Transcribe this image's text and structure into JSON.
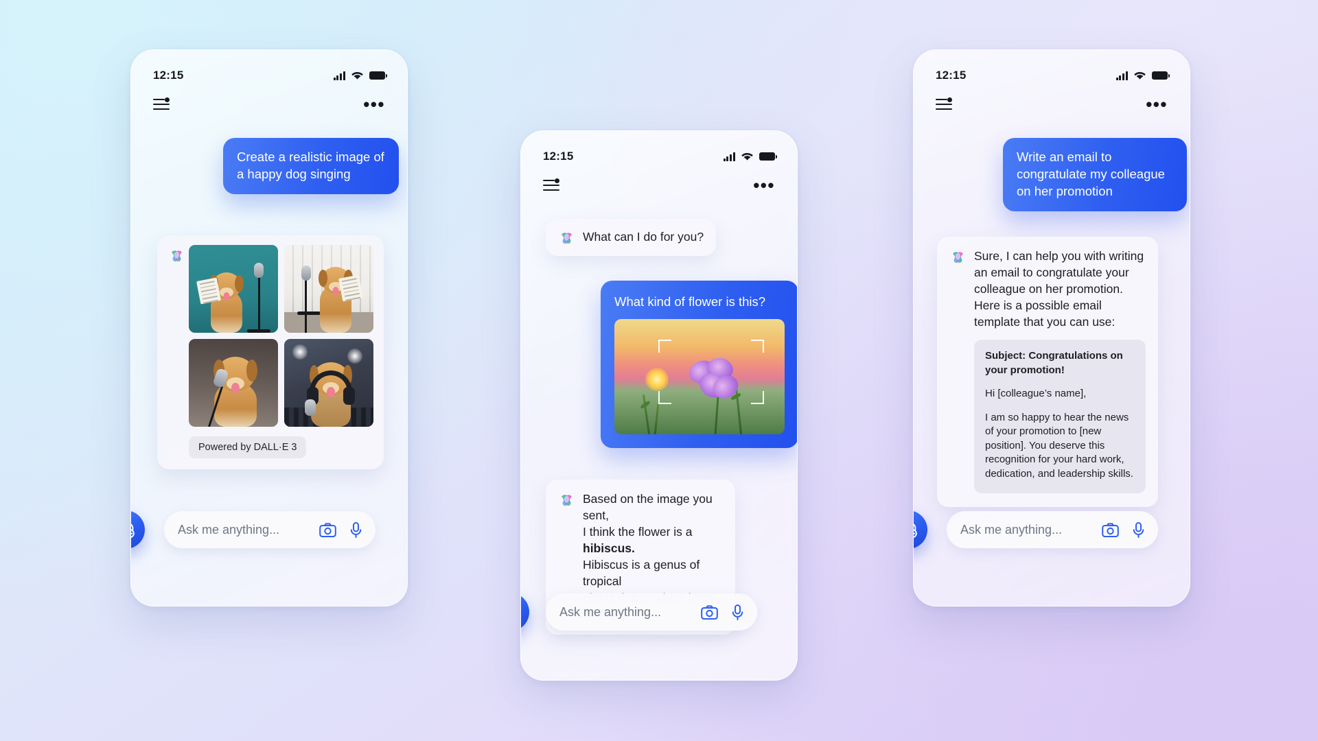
{
  "brand": {
    "name": "Copilot",
    "accent": "#2f5ff0",
    "bubble_ai_bg": "#f8f7fd"
  },
  "phones": [
    {
      "id": "phone-1",
      "status": {
        "time": "12:15",
        "signal_icon": "signal-bars-icon",
        "wifi_icon": "wifi-icon",
        "battery_icon": "battery-icon"
      },
      "appbar": {
        "menu_icon": "menu-icon",
        "more_icon": "more-options-icon"
      },
      "user_message": "Create a realistic image of a happy dog singing",
      "image_results": {
        "logo_icon": "copilot-logo-icon",
        "tiles": [
          "dog singing into studio microphone holding sheet music, teal background",
          "golden retriever standing with sheet music in front of microphone, bright room",
          "golden retriever singing into microphone, dark studio background",
          "golden retriever with headphones singing into microphone on stage"
        ],
        "credit": "Powered by DALL·E 3"
      },
      "composer": {
        "placeholder": "Ask me anything...",
        "camera_icon": "camera-icon",
        "mic_icon": "microphone-icon",
        "fab_icon": "new-chat-icon"
      }
    },
    {
      "id": "phone-2",
      "status": {
        "time": "12:15",
        "signal_icon": "signal-bars-icon",
        "wifi_icon": "wifi-icon",
        "battery_icon": "battery-icon"
      },
      "appbar": {
        "menu_icon": "menu-icon",
        "more_icon": "more-options-icon"
      },
      "greeting": "What can I do for you?",
      "user_message": "What kind of flower is this?",
      "attached_image": "purple hibiscus flower at sunset with focus frame",
      "ai_reply": {
        "line1": "Based on the image you sent,",
        "line2_prefix": "I think the flower is a ",
        "line2_bold": "hibiscus.",
        "line3": "Hibiscus is a genus of tropical",
        "line4_faded": "plants that produce large, showy"
      },
      "composer": {
        "placeholder": "Ask me anything...",
        "camera_icon": "camera-icon",
        "mic_icon": "microphone-icon",
        "fab_icon": "new-chat-icon"
      }
    },
    {
      "id": "phone-3",
      "status": {
        "time": "12:15",
        "signal_icon": "signal-bars-icon",
        "wifi_icon": "wifi-icon",
        "battery_icon": "battery-icon"
      },
      "appbar": {
        "menu_icon": "menu-icon",
        "more_icon": "more-options-icon"
      },
      "user_message": "Write an email to congratulate my colleague on her promotion",
      "ai_reply": "Sure, I can help you with writing an email to congratulate your colleague on her promotion. Here is a possible email template that you can use:",
      "email_template": {
        "subject": "Subject: Congratulations on your promotion!",
        "greeting": "Hi [colleague’s name],",
        "body": "I am so happy to hear the news of your promotion to [new position]. You deserve this recognition for your hard work, dedication, and leadership skills."
      },
      "composer": {
        "placeholder": "Ask me anything...",
        "camera_icon": "camera-icon",
        "mic_icon": "microphone-icon",
        "fab_icon": "new-chat-icon"
      }
    }
  ]
}
